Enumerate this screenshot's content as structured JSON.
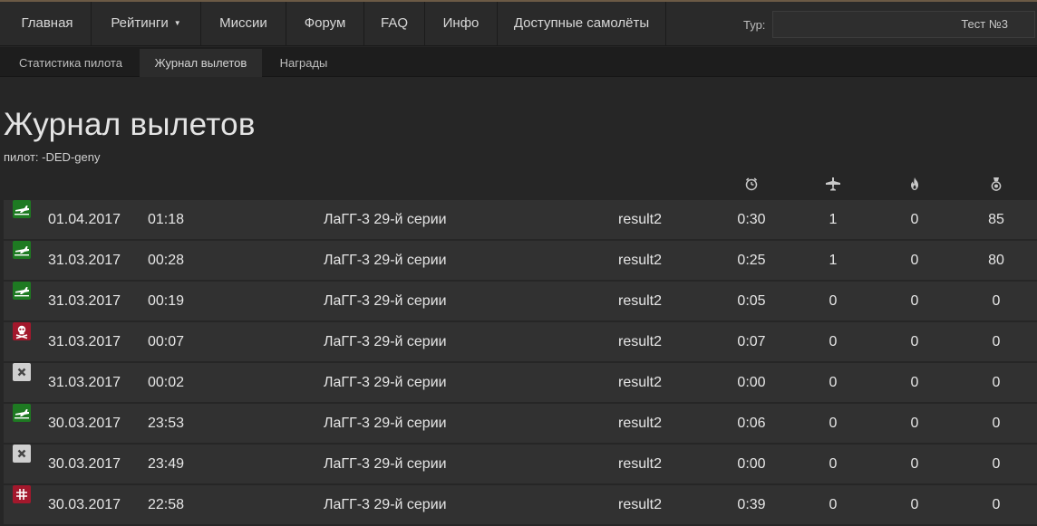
{
  "nav": {
    "items": [
      {
        "label": "Главная",
        "name": "nav-item-home"
      },
      {
        "label": "Рейтинги",
        "name": "nav-item-ratings",
        "caret": "▼"
      },
      {
        "label": "Миссии",
        "name": "nav-item-missions"
      },
      {
        "label": "Форум",
        "name": "nav-item-forum"
      },
      {
        "label": "FAQ",
        "name": "nav-item-faq"
      },
      {
        "label": "Инфо",
        "name": "nav-item-info"
      },
      {
        "label": "Доступные самолёты",
        "name": "nav-item-available-planes"
      }
    ],
    "tour_label": "Тур:",
    "tour_value": "Тест №3"
  },
  "subnav": {
    "tabs": [
      {
        "label": "Статистика пилота",
        "name": "tab-pilot-stats",
        "active": false
      },
      {
        "label": "Журнал вылетов",
        "name": "tab-sortie-log",
        "active": true
      },
      {
        "label": "Награды",
        "name": "tab-awards",
        "active": false
      }
    ]
  },
  "page": {
    "title": "Журнал вылетов",
    "pilot_line": "пилот: -DED-geny"
  },
  "columns": {
    "icons": [
      "clock-icon",
      "plane-icon",
      "fire-icon",
      "medal-icon"
    ]
  },
  "colors": {
    "landed": "#1e7a22",
    "killed": "#a3182c",
    "disconnected": "#cfcfcf",
    "captured": "#a3182c"
  },
  "sorties": [
    {
      "status": "landed",
      "date": "01.04.2017",
      "time": "01:18",
      "aircraft": "ЛаГГ-3 29-й серии",
      "mission": "result2",
      "duration": "0:30",
      "aircraft_kills": "1",
      "ground_kills": "0",
      "score": "85"
    },
    {
      "status": "landed",
      "date": "31.03.2017",
      "time": "00:28",
      "aircraft": "ЛаГГ-3 29-й серии",
      "mission": "result2",
      "duration": "0:25",
      "aircraft_kills": "1",
      "ground_kills": "0",
      "score": "80"
    },
    {
      "status": "landed",
      "date": "31.03.2017",
      "time": "00:19",
      "aircraft": "ЛаГГ-3 29-й серии",
      "mission": "result2",
      "duration": "0:05",
      "aircraft_kills": "0",
      "ground_kills": "0",
      "score": "0"
    },
    {
      "status": "killed",
      "date": "31.03.2017",
      "time": "00:07",
      "aircraft": "ЛаГГ-3 29-й серии",
      "mission": "result2",
      "duration": "0:07",
      "aircraft_kills": "0",
      "ground_kills": "0",
      "score": "0"
    },
    {
      "status": "disconnected",
      "date": "31.03.2017",
      "time": "00:02",
      "aircraft": "ЛаГГ-3 29-й серии",
      "mission": "result2",
      "duration": "0:00",
      "aircraft_kills": "0",
      "ground_kills": "0",
      "score": "0"
    },
    {
      "status": "landed",
      "date": "30.03.2017",
      "time": "23:53",
      "aircraft": "ЛаГГ-3 29-й серии",
      "mission": "result2",
      "duration": "0:06",
      "aircraft_kills": "0",
      "ground_kills": "0",
      "score": "0"
    },
    {
      "status": "disconnected",
      "date": "30.03.2017",
      "time": "23:49",
      "aircraft": "ЛаГГ-3 29-й серии",
      "mission": "result2",
      "duration": "0:00",
      "aircraft_kills": "0",
      "ground_kills": "0",
      "score": "0"
    },
    {
      "status": "captured",
      "date": "30.03.2017",
      "time": "22:58",
      "aircraft": "ЛаГГ-3 29-й серии",
      "mission": "result2",
      "duration": "0:39",
      "aircraft_kills": "0",
      "ground_kills": "0",
      "score": "0"
    }
  ]
}
